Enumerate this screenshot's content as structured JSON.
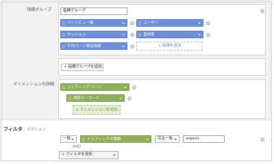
{
  "metric_group": {
    "label": "指標グループ",
    "name_value": "指標グループ",
    "metrics": [
      {
        "label": "ページビュー数"
      },
      {
        "label": "ユーザー"
      },
      {
        "label": "セッション"
      },
      {
        "label": "直帰率"
      },
      {
        "label": "平均ページ滞在時間"
      }
    ],
    "add_metric_label": "+ 指標を追加",
    "add_group_label": "+ 指標グループを追加"
  },
  "dimension_drilldown": {
    "label": "ディメンションの詳細",
    "dimensions": [
      {
        "label": "ランディング ページ"
      },
      {
        "label": "検索キーワード"
      }
    ],
    "add_dimension_label": "+ ディメンションを追加"
  },
  "filter": {
    "title": "フィルタ",
    "optional_label": "- オプション",
    "row": {
      "include_value": "一致",
      "dimension_value": "トラフィックの種類",
      "match_type_value": "完全一致",
      "text_value": "organic"
    },
    "and_label": "AND",
    "add_filter_label": "+ フィルタを追加"
  },
  "colors": {
    "metric_chip": "#6c8fd6",
    "dimension_chip": "#8fad5b",
    "panel_bg": "#f2f2f2"
  }
}
